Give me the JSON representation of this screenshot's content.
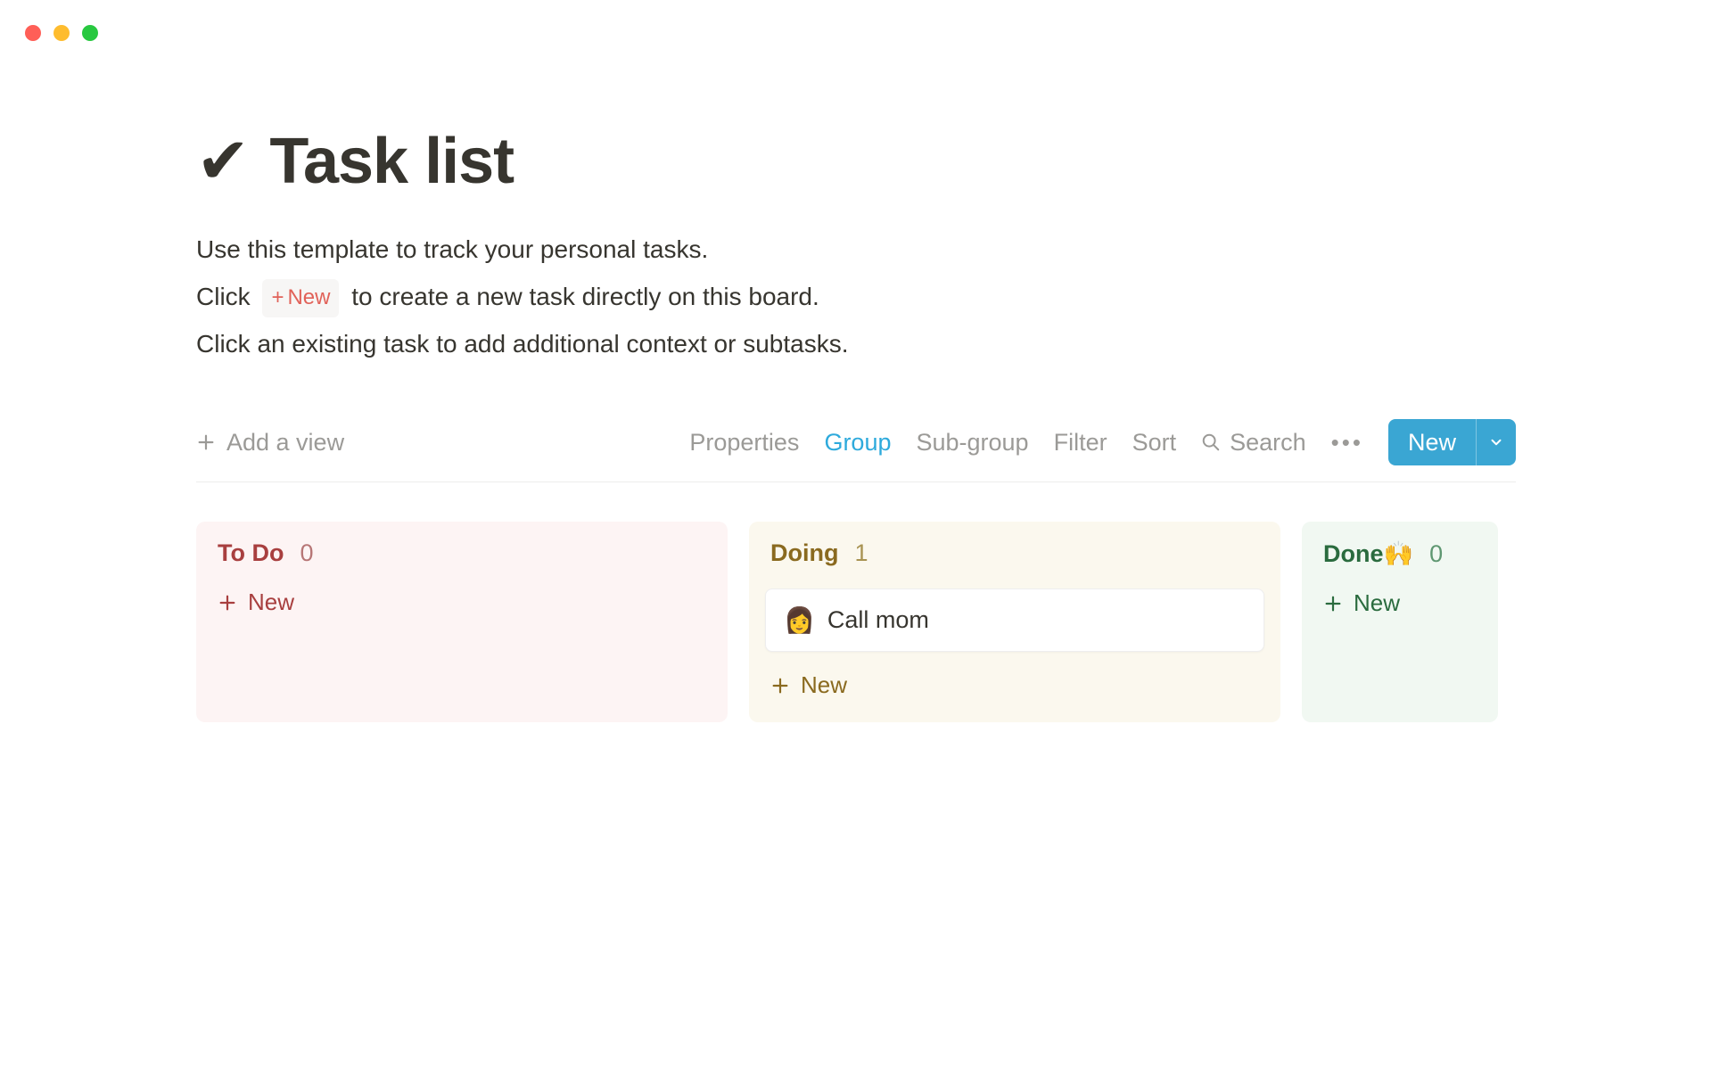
{
  "page": {
    "icon": "✔",
    "title": "Task list",
    "description_line1": "Use this template to track your personal tasks.",
    "description_line2_before": "Click",
    "description_line2_pill_plus": "+",
    "description_line2_pill_label": "New",
    "description_line2_after": "to create a new task directly on this board.",
    "description_line3": "Click an existing task to add additional context or subtasks."
  },
  "toolbar": {
    "add_view": "Add a view",
    "properties": "Properties",
    "group": "Group",
    "sub_group": "Sub-group",
    "filter": "Filter",
    "sort": "Sort",
    "search": "Search",
    "more": "•••",
    "new_button": "New"
  },
  "columns": {
    "todo": {
      "title": "To Do",
      "count": "0",
      "new_label": "New"
    },
    "doing": {
      "title": "Doing",
      "count": "1",
      "new_label": "New",
      "cards": [
        {
          "emoji": "👩",
          "title": "Call mom"
        }
      ]
    },
    "done": {
      "title": "Done",
      "emoji": "🙌",
      "count": "0",
      "new_label": "New"
    }
  }
}
